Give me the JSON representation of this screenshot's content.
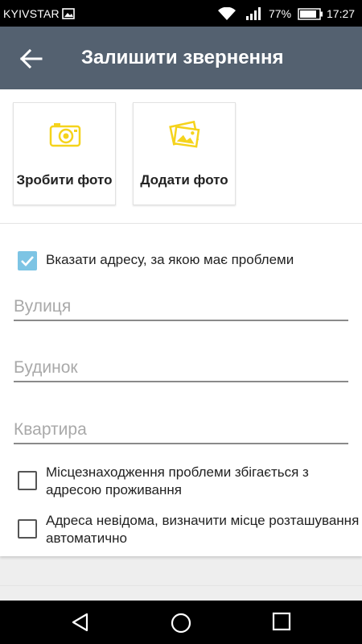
{
  "status_bar": {
    "carrier": "KYIVSTAR",
    "battery_percent": "77%",
    "time": "17:27",
    "icons": [
      "image-icon",
      "wifi-icon",
      "signal-icon",
      "battery-icon"
    ]
  },
  "app_bar": {
    "title": "Залишити звернення",
    "back_icon": "arrow-back-icon"
  },
  "photo_actions": {
    "take_photo": {
      "label": "Зробити фото",
      "icon": "camera-icon"
    },
    "add_photo": {
      "label": "Додати фото",
      "icon": "gallery-icon"
    }
  },
  "address_section": {
    "specify_address": {
      "label": "Вказати адресу, за якою має проблеми",
      "checked": true
    },
    "street": {
      "placeholder": "Вулиця",
      "value": ""
    },
    "building": {
      "placeholder": "Будинок",
      "value": ""
    },
    "apartment": {
      "placeholder": "Квартира",
      "value": ""
    },
    "matches_residence": {
      "label": "Місцезнаходження проблеми збігається з адресою проживання",
      "checked": false
    },
    "auto_location": {
      "label": "Адреса невідома, визначити місце розташування автоматично",
      "checked": false
    }
  },
  "nav_bar": {
    "buttons": [
      "back-triangle-icon",
      "home-circle-icon",
      "recents-square-icon"
    ]
  },
  "colors": {
    "app_bar": "#546170",
    "accent_yellow": "#f5d31c",
    "checkbox_checked": "#7dc4e4"
  }
}
